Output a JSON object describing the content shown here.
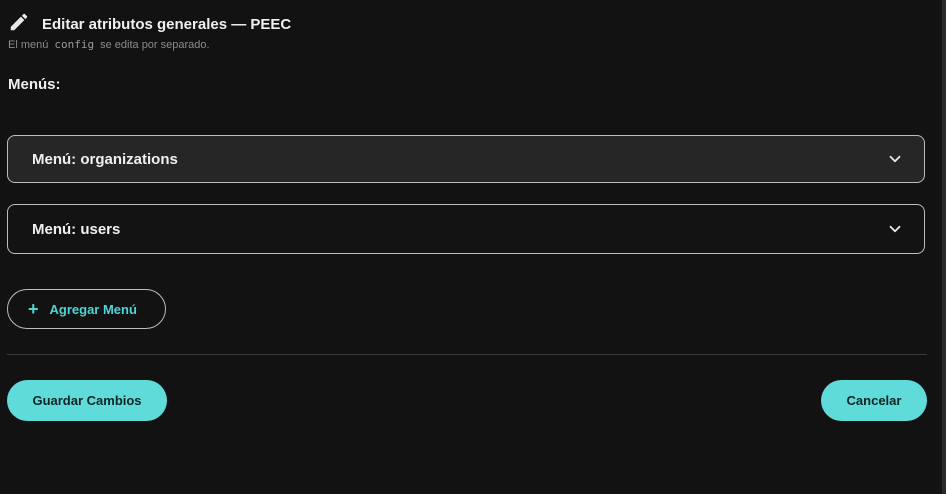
{
  "header": {
    "title": "Editar atributos generales — PEEC",
    "subtitle_before": "El menú",
    "subtitle_code": "config",
    "subtitle_after": "se edita por separado.",
    "icon": "pencil-icon"
  },
  "menus": {
    "label": "Menús:",
    "items": [
      {
        "label": "Menú: organizations",
        "expanded": false
      },
      {
        "label": "Menú: users",
        "expanded": false
      }
    ],
    "add_label": "Agregar Menú",
    "add_icon": "plus-icon"
  },
  "actions": {
    "save_label": "Guardar Cambios",
    "cancel_label": "Cancelar"
  },
  "colors": {
    "background": "#121212",
    "accent": "#5fdbda",
    "accent_text": "#4fd6d6"
  }
}
